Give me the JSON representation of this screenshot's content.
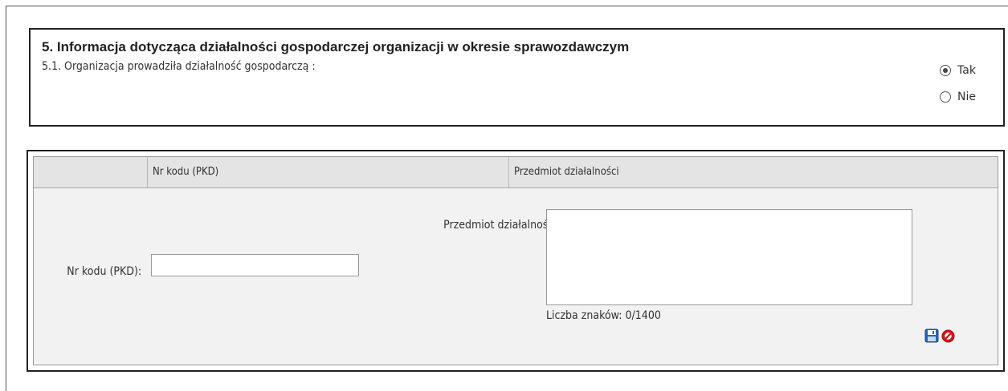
{
  "section": {
    "title": "5. Informacja dotycząca działalności gospodarczej organizacji w okresie sprawozdawczym",
    "question": "5.1. Organizacja prowadziła działalność gospodarczą :",
    "options": [
      {
        "label": "Tak",
        "selected": true
      },
      {
        "label": "Nie",
        "selected": false
      }
    ]
  },
  "table": {
    "columns": [
      "",
      "Nr kodu (PKD)",
      "Przedmiot działalności"
    ]
  },
  "form": {
    "pkd_label": "Nr kodu (PKD):",
    "pkd_value": "",
    "przedmiot_label": "Przedmiot działalności:",
    "przedmiot_value": "",
    "char_counter": "Liczba znaków: 0/1400"
  },
  "icons": {
    "save": "save-icon",
    "cancel": "cancel-icon"
  },
  "colors": {
    "header_bg": "#e4e4e4",
    "form_bg": "#f2f2f2",
    "save_blue": "#2b63b8",
    "cancel_red": "#d6161f"
  }
}
